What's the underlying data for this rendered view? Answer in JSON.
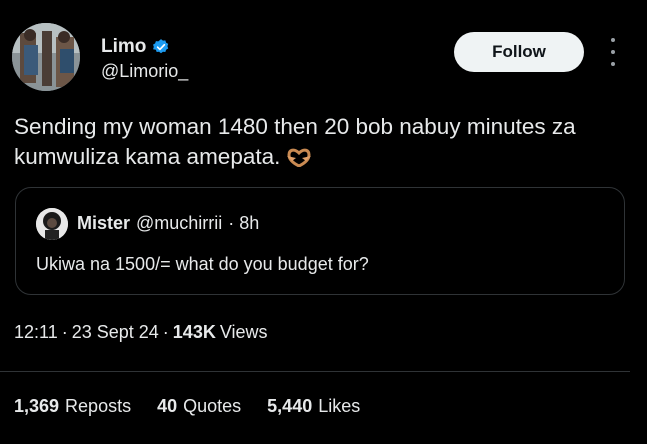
{
  "author": {
    "name": "Limo",
    "handle": "@Limorio_",
    "verified": true,
    "verified_color": "#1d9bf0"
  },
  "follow_label": "Follow",
  "tweet_text": "Sending my woman 1480 then 20 bob nabuy minutes za kumwuliza kama amepata.",
  "tweet_emoji": "heart-hands-emoji",
  "quote": {
    "name": "Mister",
    "handle": "@muchirrii",
    "time": "· 8h",
    "text": "Ukiwa na 1500/= what do you budget for?"
  },
  "meta": {
    "time": "12:11",
    "sep1": "·",
    "date": "23 Sept 24",
    "sep2": "·",
    "views_count": "143K",
    "views_label": "Views"
  },
  "stats": {
    "reposts_count": "1,369",
    "reposts_label": "Reposts",
    "quotes_count": "40",
    "quotes_label": "Quotes",
    "likes_count": "5,440",
    "likes_label": "Likes"
  }
}
